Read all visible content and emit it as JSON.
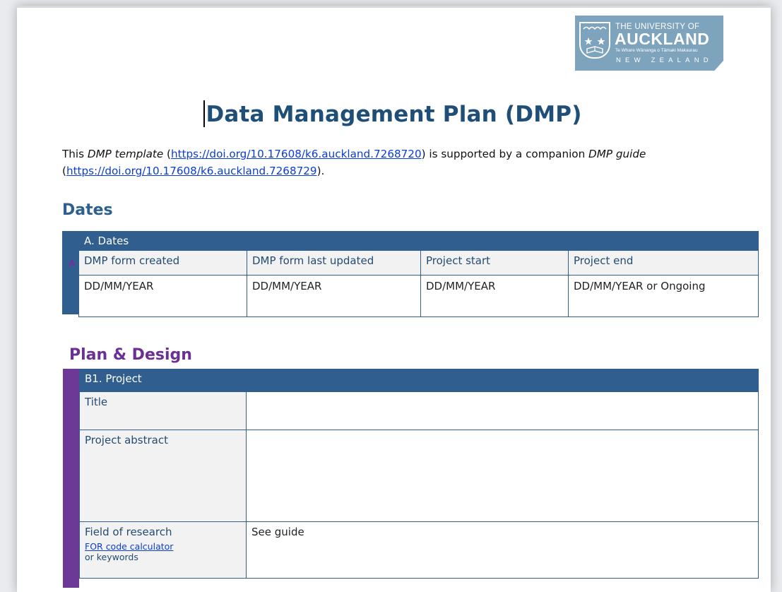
{
  "logo": {
    "line1": "THE UNIVERSITY OF",
    "line2": "AUCKLAND",
    "line3": "Te Whare Wānanga o Tāmaki Makaurau",
    "line4": "NEW ZEALAND"
  },
  "document": {
    "title": "Data Management Plan (DMP)",
    "intro": {
      "t1": "This ",
      "dmp_template": "DMP template",
      "t2": " (",
      "link1": "https://doi.org/10.17608/k6.auckland.7268720",
      "t3": ") is supported by a companion ",
      "dmp_guide": "DMP guide",
      "t4": " (",
      "link2": "https://doi.org/10.17608/k6.auckland.7268729",
      "t5": ")."
    }
  },
  "dates_section": {
    "heading": "Dates",
    "band_letter": "A",
    "table_header": "A. Dates",
    "columns": [
      "DMP form created",
      "DMP form last updated",
      "Project start",
      "Project end"
    ],
    "values": [
      "DD/MM/YEAR",
      "DD/MM/YEAR",
      "DD/MM/YEAR",
      "DD/MM/YEAR or Ongoing"
    ]
  },
  "plan_section": {
    "heading": "Plan & Design",
    "table_header": "B1. Project",
    "rows": [
      {
        "label": "Title",
        "value": ""
      },
      {
        "label": "Project abstract",
        "value": ""
      },
      {
        "label": "Field of research",
        "link": "FOR code calculator",
        "note": "or keywords",
        "value": "See guide"
      }
    ]
  }
}
